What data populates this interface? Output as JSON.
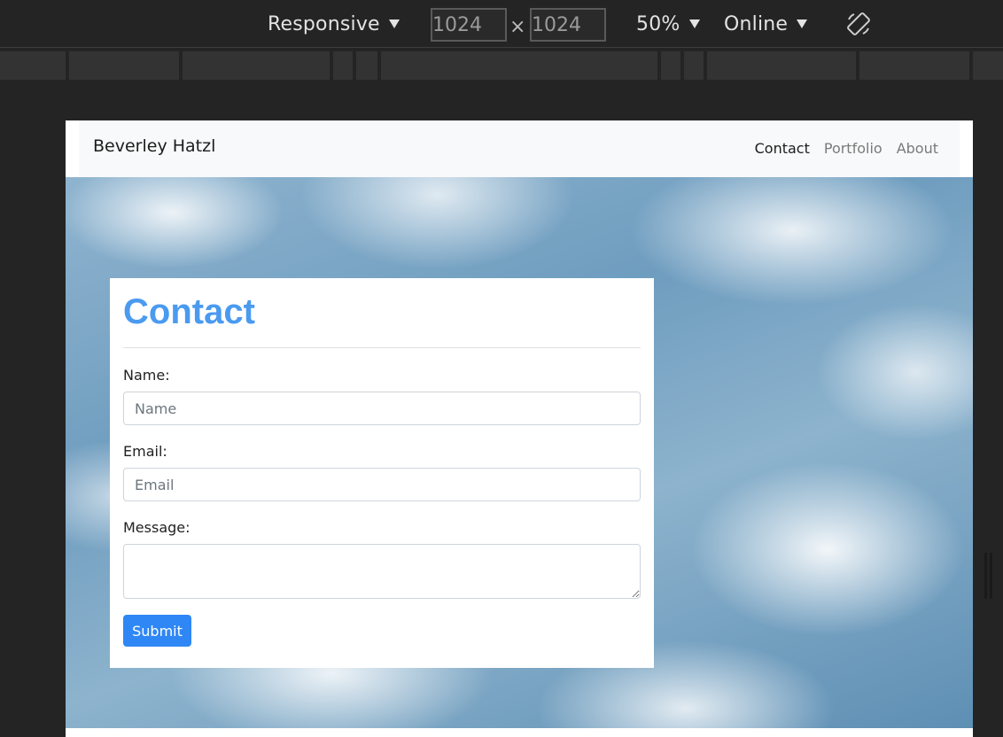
{
  "toolbar": {
    "device": "Responsive",
    "width": "1024",
    "height": "1024",
    "times": "×",
    "zoom": "50%",
    "throttle": "Online",
    "rotate_icon": "rotate-icon"
  },
  "site": {
    "brand": "Beverley Hatzl",
    "nav": [
      {
        "label": "Contact",
        "active": true
      },
      {
        "label": "Portfolio",
        "active": false
      },
      {
        "label": "About",
        "active": false
      }
    ]
  },
  "contact_form": {
    "title": "Contact",
    "name_label": "Name:",
    "name_placeholder": "Name",
    "email_label": "Email:",
    "email_placeholder": "Email",
    "message_label": "Message:",
    "message_value": "",
    "submit_label": "Submit"
  },
  "colors": {
    "title": "#4a9af0",
    "button": "#2f87f5",
    "navbar_bg": "#f8f9fa",
    "devtools_bg": "#242424"
  }
}
